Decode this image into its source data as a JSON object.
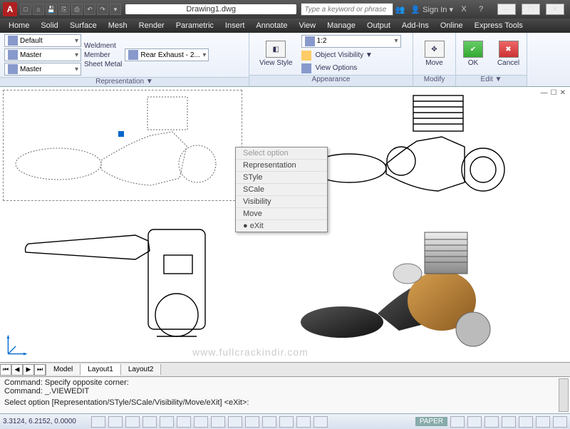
{
  "app": {
    "letter": "A"
  },
  "title": "Drawing1.dwg",
  "search_placeholder": "Type a keyword or phrase",
  "signin": "Sign In",
  "menubar": [
    "Home",
    "Solid",
    "Surface",
    "Mesh",
    "Render",
    "Parametric",
    "Insert",
    "Annotate",
    "View",
    "Manage",
    "Output",
    "Add-Ins",
    "Online",
    "Express Tools"
  ],
  "ribbon": {
    "panel1": {
      "combos_left": [
        "Default",
        "Master",
        "Master"
      ],
      "combos_mid": [
        "Weldment",
        "Member",
        "Sheet Metal"
      ],
      "combos_right": "Rear Exhaust - 2...",
      "title": "Representation ▼"
    },
    "panel2": {
      "view_style": "View Style",
      "scale": "1:2",
      "obj_vis": "Object Visibility ▼",
      "view_opts": "View Options",
      "title": "Appearance"
    },
    "panel3": {
      "move": "Move",
      "title": "Modify"
    },
    "panel4": {
      "ok": "OK",
      "cancel": "Cancel",
      "title": "Edit ▼"
    }
  },
  "context_menu": {
    "head": "Select option",
    "items": [
      "Representation",
      "STyle",
      "SCale",
      "Visibility",
      "Move",
      "eXit"
    ]
  },
  "tabs": {
    "model": "Model",
    "layout1": "Layout1",
    "layout2": "Layout2"
  },
  "cmd": {
    "l1": "Command: Specify opposite corner:",
    "l2": "Command: _.VIEWEDIT",
    "l3": "Select option [Representation/STyle/SCale/Visibility/Move/eXit] <eXit>:"
  },
  "status": {
    "coords": "3.3124, 6.2152, 0.0000",
    "paper": "PAPER"
  },
  "watermark": "www.fullcrackindir.com"
}
